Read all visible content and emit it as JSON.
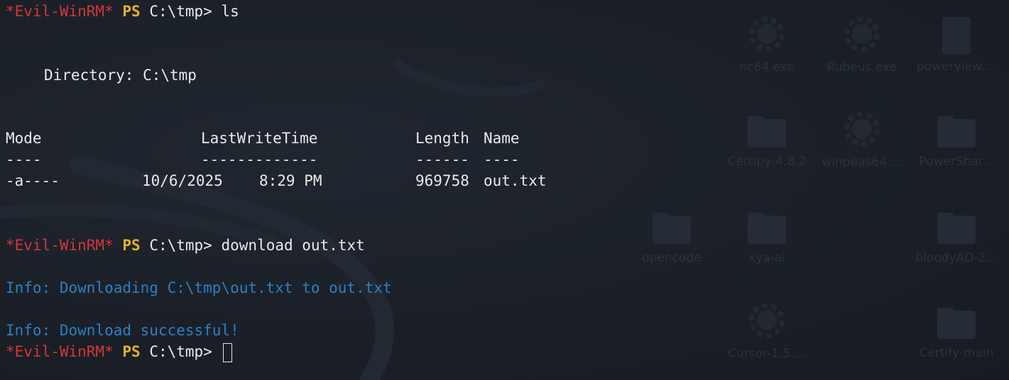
{
  "terminal": {
    "prompt": {
      "name": "*Evil-WinRM*",
      "ps": "PS",
      "path": "C:\\tmp>"
    },
    "commands": {
      "ls": "ls",
      "download": "download out.txt"
    },
    "directory_line": "Directory: C:\\tmp",
    "table": {
      "headers": {
        "mode": "Mode",
        "lastwrite": "LastWriteTime",
        "length": "Length",
        "name": "Name"
      },
      "separators": {
        "mode": "----",
        "lastwrite": "-------------",
        "length": "------",
        "name": "----"
      },
      "rows": [
        {
          "mode": "-a----",
          "date": "10/6/2025",
          "time": "8:29 PM",
          "length": "969758",
          "name": "out.txt"
        }
      ]
    },
    "info_lines": [
      "Info: Downloading C:\\tmp\\out.txt to out.txt",
      "Info: Download successful!"
    ]
  },
  "desktop": {
    "icons": [
      {
        "label": "nc64.exe",
        "icon": "gear-icon"
      },
      {
        "label": "Rubeus.exe",
        "icon": "gear-icon"
      },
      {
        "label": "powerview....",
        "icon": "script-file-icon"
      },
      {
        "label": "Certipy-4.8.2",
        "icon": "folder-icon"
      },
      {
        "label": "winpeas64....",
        "icon": "gear-icon"
      },
      {
        "label": "PowerShar...",
        "icon": "folder-icon"
      },
      {
        "label": "opencode",
        "icon": "folder-icon"
      },
      {
        "label": "xya-ai",
        "icon": "folder-icon"
      },
      {
        "label": "bloodyAD-2...",
        "icon": "folder-icon"
      },
      {
        "label": "Cursor-1.5....",
        "icon": "gear-icon"
      },
      {
        "label": "Certify-main",
        "icon": "folder-icon"
      }
    ]
  },
  "colors": {
    "prompt_name": "#d2363a",
    "prompt_ps": "#e5b125",
    "info": "#2d7fc3",
    "text": "#e9e9e9",
    "background": "#1b2028"
  }
}
